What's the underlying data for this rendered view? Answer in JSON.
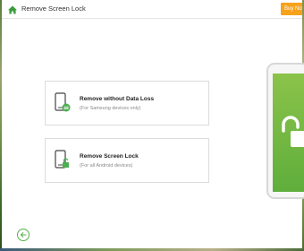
{
  "window": {
    "title": "Remove Screen Lock",
    "buy_label": "Buy No"
  },
  "options": [
    {
      "title": "Remove without Data Loss",
      "subtitle": "(For Samsung devices only)",
      "icon": "phone-data-icon"
    },
    {
      "title": "Remove Screen Lock",
      "subtitle": "(For all Android devices)",
      "icon": "phone-unlock-icon"
    }
  ],
  "navigation": {
    "back_icon": "back-arrow-icon"
  },
  "colors": {
    "accent_green": "#56b24a",
    "buy_orange": "#f7a21b",
    "phone_screen_green": "#7cbb43"
  }
}
